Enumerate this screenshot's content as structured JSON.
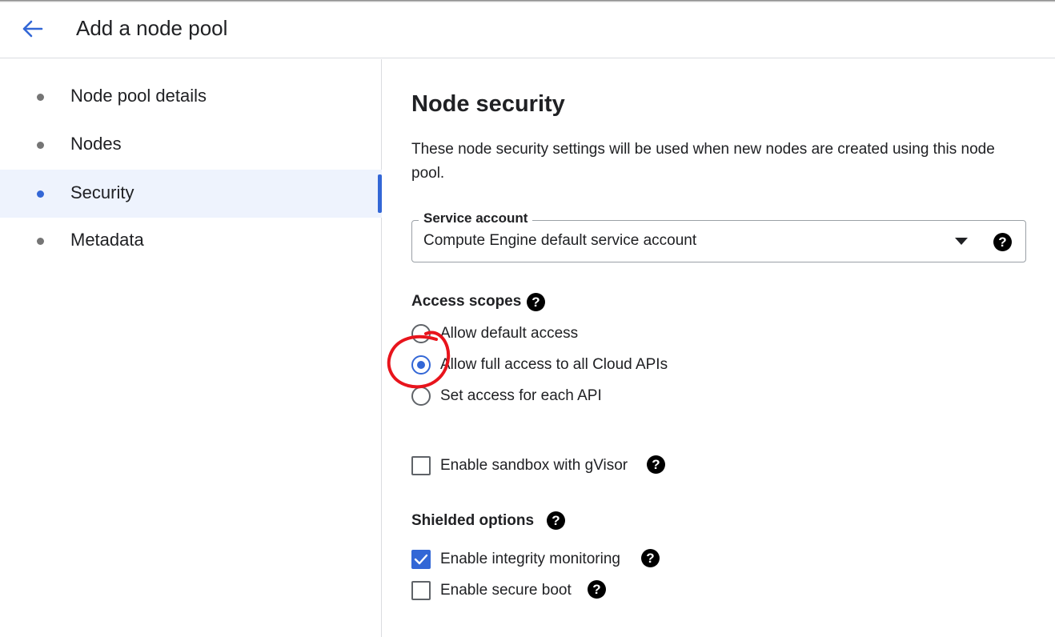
{
  "header": {
    "title": "Add a node pool",
    "back_icon": "arrow-back-icon"
  },
  "sidebar": {
    "items": [
      {
        "label": "Node pool details",
        "active": false
      },
      {
        "label": "Nodes",
        "active": false
      },
      {
        "label": "Security",
        "active": true
      },
      {
        "label": "Metadata",
        "active": false
      }
    ]
  },
  "main": {
    "title": "Node security",
    "description": "These node security settings will be used when new nodes are created using this node pool.",
    "service_account": {
      "label": "Service account",
      "value": "Compute Engine default service account"
    },
    "access_scopes": {
      "label": "Access scopes",
      "options": [
        {
          "label": "Allow default access",
          "selected": false
        },
        {
          "label": "Allow full access to all Cloud APIs",
          "selected": true
        },
        {
          "label": "Set access for each API",
          "selected": false
        }
      ]
    },
    "sandbox": {
      "label": "Enable sandbox with gVisor",
      "checked": false
    },
    "shielded": {
      "label": "Shielded options",
      "options": [
        {
          "label": "Enable integrity monitoring",
          "checked": true
        },
        {
          "label": "Enable secure boot",
          "checked": false
        }
      ]
    }
  },
  "colors": {
    "accent": "#3367d6",
    "annotation": "#e8141c",
    "active_nav_bg": "#eef3fd"
  }
}
